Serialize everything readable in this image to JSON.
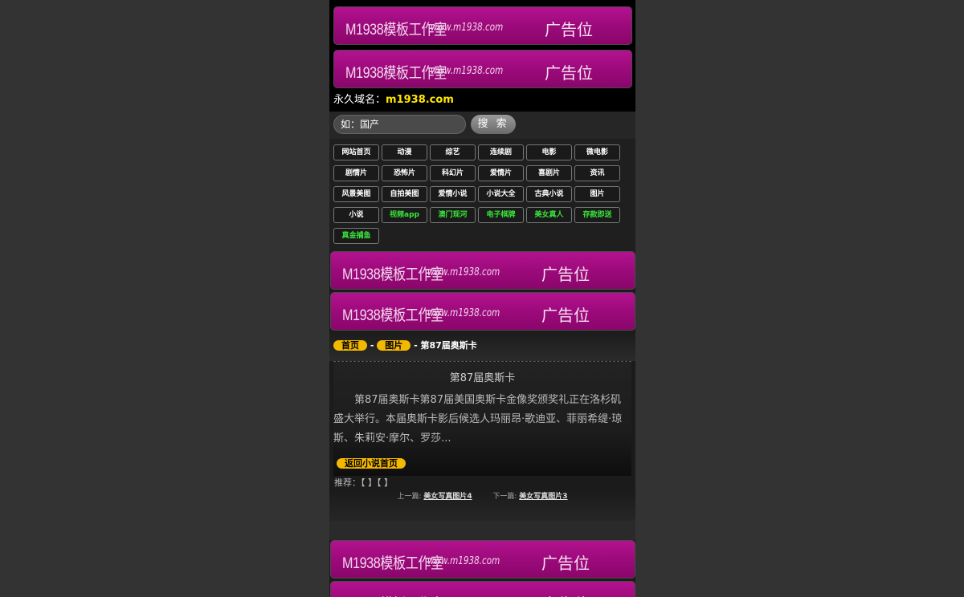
{
  "ad": {
    "brand": "M1938模板工作室",
    "url": "www.m1938.com",
    "slot": "广告位"
  },
  "domain": {
    "label": "永久域名：",
    "value": "m1938.com"
  },
  "search": {
    "placeholder": "如：国产",
    "button": "搜 索"
  },
  "nav": [
    {
      "label": "网站首页",
      "green": false
    },
    {
      "label": "动漫",
      "green": false
    },
    {
      "label": "综艺",
      "green": false
    },
    {
      "label": "连续剧",
      "green": false
    },
    {
      "label": "电影",
      "green": false
    },
    {
      "label": "微电影",
      "green": false
    },
    {
      "label": "剧情片",
      "green": false
    },
    {
      "label": "恐怖片",
      "green": false
    },
    {
      "label": "科幻片",
      "green": false
    },
    {
      "label": "爱情片",
      "green": false
    },
    {
      "label": "喜剧片",
      "green": false
    },
    {
      "label": "资讯",
      "green": false
    },
    {
      "label": "风景美图",
      "green": false
    },
    {
      "label": "自拍美图",
      "green": false
    },
    {
      "label": "爱情小说",
      "green": false
    },
    {
      "label": "小说大全",
      "green": false
    },
    {
      "label": "古典小说",
      "green": false
    },
    {
      "label": "图片",
      "green": false
    },
    {
      "label": "小说",
      "green": false
    },
    {
      "label": "视频app",
      "green": true
    },
    {
      "label": "澳门现河",
      "green": true
    },
    {
      "label": "电子棋牌",
      "green": true
    },
    {
      "label": "美女真人",
      "green": true
    },
    {
      "label": "存款即送",
      "green": true
    },
    {
      "label": "真金捕鱼",
      "green": true
    }
  ],
  "breadcrumb": {
    "home": "首页",
    "sep": "-",
    "category": "图片",
    "current": "- 第87届奥斯卡"
  },
  "article": {
    "title": "第87届奥斯卡",
    "body": "第87届奥斯卡第87届美国奥斯卡金像奖颁奖礼正在洛杉矶盛大举行。本届奥斯卡影后候选人玛丽昂·歌迪亚、菲丽希缇·琼斯、朱莉安·摩尔、罗莎...",
    "back": "返回小说首页"
  },
  "recommend": "推荐：【 】【 】",
  "prevnext": {
    "prev_label": "上一篇:",
    "prev_link": "美女写真图片4",
    "next_label": "下一篇:",
    "next_link": "美女写真图片3"
  }
}
